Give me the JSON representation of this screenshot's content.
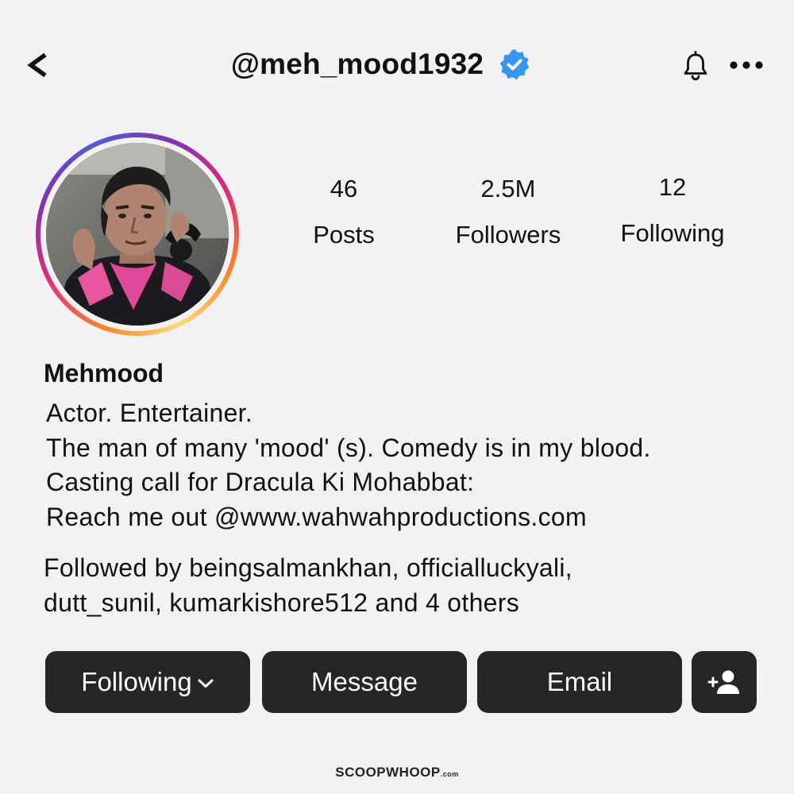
{
  "header": {
    "username": "@meh_mood1932",
    "back_icon": "chevron-left-icon",
    "verified_icon": "verified-badge-icon",
    "notification_icon": "bell-icon",
    "more_icon": "more-horizontal-icon",
    "verified_color": "#3797f0"
  },
  "profile": {
    "avatar_icon": "profile-photo",
    "stats": [
      {
        "value": "46",
        "label": "Posts"
      },
      {
        "value": "2.5M",
        "label": "Followers"
      },
      {
        "value": "12",
        "label": "Following"
      }
    ],
    "display_name": "Mehmood",
    "bio_lines": [
      "Actor. Entertainer.",
      "The man of many 'mood' (s). Comedy is in my blood.",
      "Casting call for Dracula Ki Mohabbat:",
      "Reach me out @www.wahwahproductions.com"
    ],
    "followed_by_lines": [
      "Followed by beingsalmankhan, officialluckyali,",
      "dutt_sunil, kumarkishore512 and 4 others"
    ]
  },
  "actions": {
    "following_label": "Following",
    "message_label": "Message",
    "email_label": "Email",
    "add_user_icon": "add-user-icon",
    "button_color": "#262626"
  },
  "watermark": {
    "brand": "SCOOPWHOOP",
    "tld": ".com"
  }
}
